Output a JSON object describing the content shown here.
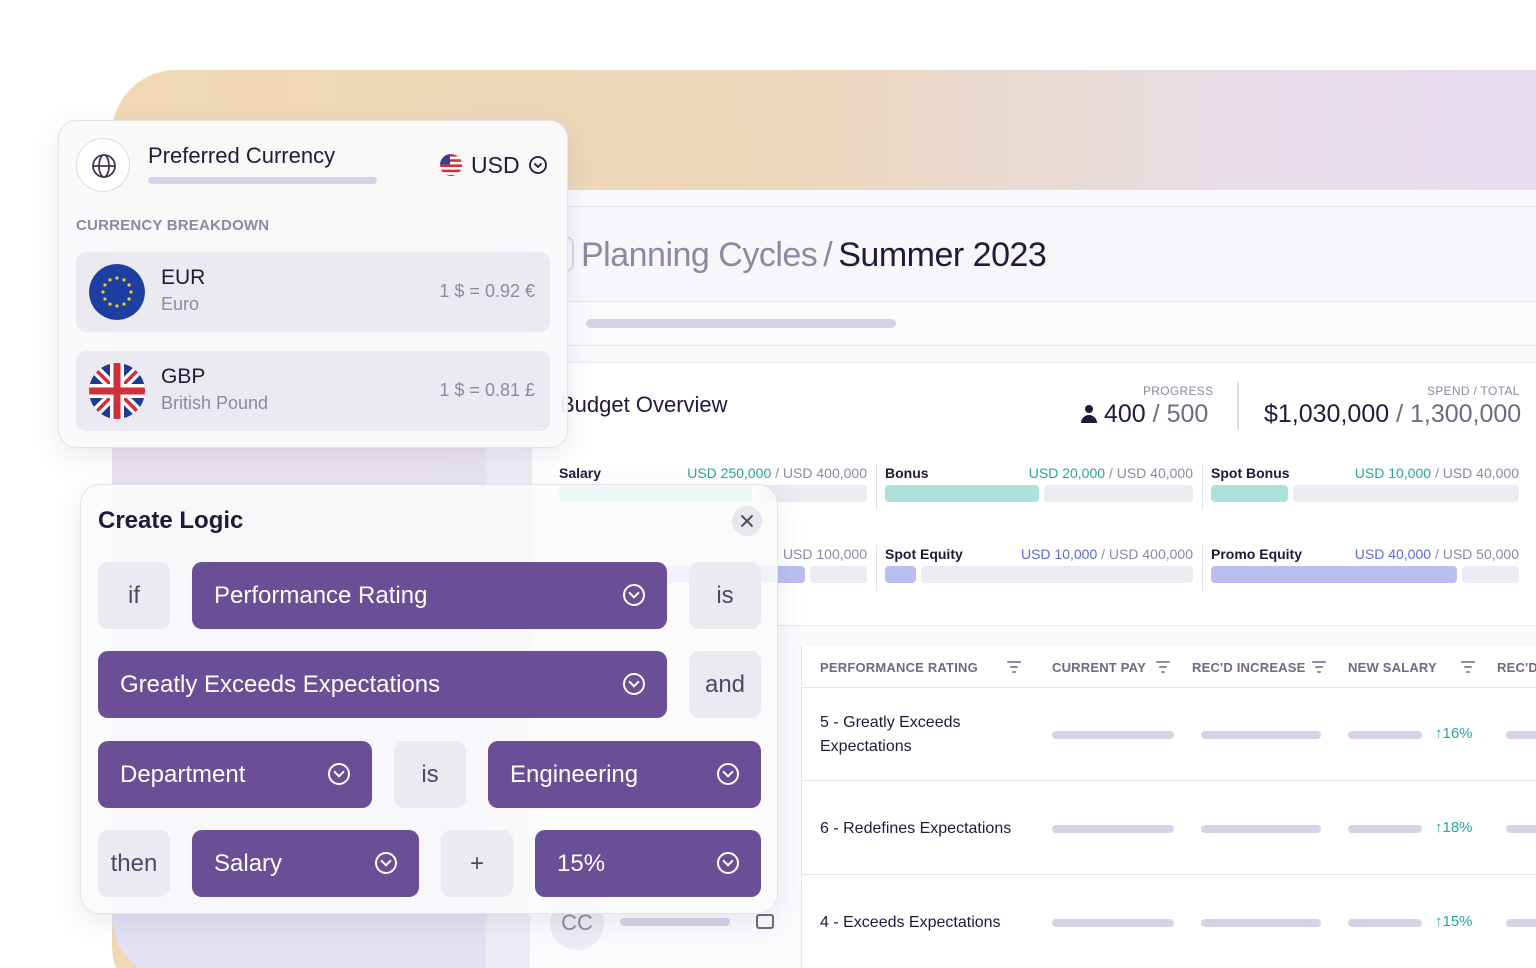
{
  "colors": {
    "accent_purple": "#6a4e96",
    "teal": "#2aa596",
    "blue": "#5b6bd8",
    "teal_fill": "#ace2d9",
    "blue_fill": "#b9c0f0"
  },
  "header": {
    "breadcrumb_parent": "Planning Cycles",
    "breadcrumb_sep": "/",
    "breadcrumb_current": "Summer 2023"
  },
  "budget": {
    "title": "Budget Overview",
    "progress_label": "PROGRESS",
    "progress_done": "400",
    "progress_total": "/ 500",
    "spend_label": "SPEND / TOTAL",
    "spend_value": "$1,030,000",
    "spend_total": "/ 1,300,000",
    "items": [
      {
        "name": "Salary",
        "spent": "USD 250,000",
        "total": "/ USD 400,000",
        "fraction": 0.625
      },
      {
        "name": "Bonus",
        "spent": "USD 20,000",
        "total": "/ USD 40,000",
        "fraction": 0.5
      },
      {
        "name": "Spot Bonus",
        "spent": "USD 10,000",
        "total": "/ USD 40,000",
        "fraction": 0.25
      },
      {
        "name": "",
        "spent": "",
        "total": "USD 100,000",
        "fraction": 0.8
      },
      {
        "name": "Spot Equity",
        "spent": "USD 10,000",
        "total": "/ USD 400,000",
        "fraction": 0.1
      },
      {
        "name": "Promo Equity",
        "spent": "USD 40,000",
        "total": "/ USD 50,000",
        "fraction": 0.8
      }
    ]
  },
  "table": {
    "columns": [
      "PERFORMANCE RATING",
      "CURRENT PAY",
      "REC'D INCREASE",
      "NEW SALARY",
      "REC'D"
    ],
    "rows": [
      {
        "rating": "5 - Greatly Exceeds Expectations",
        "new_salary_change": "↑16%"
      },
      {
        "rating": "6 - Redefines Expectations",
        "new_salary_change": "↑18%"
      },
      {
        "rating": "4 - Exceeds Expectations",
        "new_salary_change": "↑15%"
      }
    ],
    "avatar_initials": "CC"
  },
  "currency": {
    "title": "Preferred Currency",
    "selected": "USD",
    "breakdown_label": "CURRENCY BREAKDOWN",
    "rows": [
      {
        "code": "EUR",
        "name": "Euro",
        "rate": "1 $ = 0.92 €",
        "icon": "eu-flag-icon"
      },
      {
        "code": "GBP",
        "name": "British Pound",
        "rate": "1 $ = 0.81 £",
        "icon": "uk-flag-icon"
      }
    ]
  },
  "logic": {
    "title": "Create Logic",
    "if": "if",
    "field1": "Performance Rating",
    "is1": "is",
    "value1": "Greatly Exceeds Expectations",
    "and": "and",
    "field2": "Department",
    "is2": "is",
    "value2": "Engineering",
    "then": "then",
    "target": "Salary",
    "op": "+",
    "amount": "15%"
  }
}
